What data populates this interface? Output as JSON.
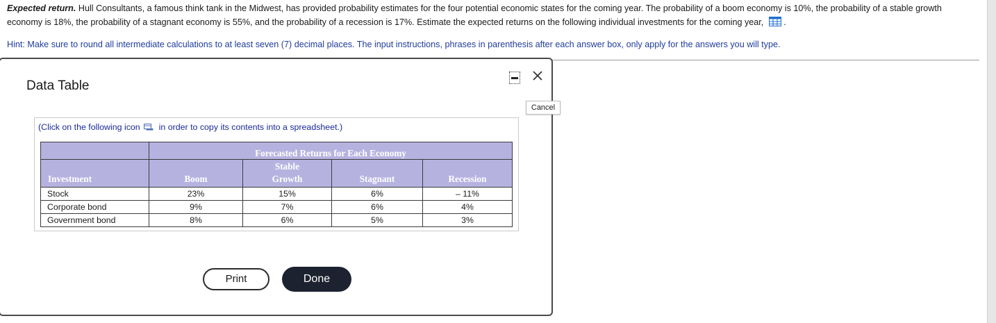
{
  "problem": {
    "lead": "Expected return.",
    "text": "Hull Consultants, a famous think tank in the Midwest, has provided probability estimates for the four potential economic states for the coming year.  The probability of a boom economy is 10%, the probability of a stable growth economy is 18%, the probability of a stagnant economy is 55%, and the probability of a recession is 17%.  Estimate the expected returns on the following individual investments for the coming year,",
    "after_icon": "."
  },
  "hint": "Hint: Make sure to round all intermediate calculations to at least seven (7) decimal places. The input instructions, phrases in parenthesis after each answer box, only apply for the answers you will type.",
  "dialog": {
    "title": "Data Table",
    "cancel_label": "Cancel",
    "copy_note_before": "(Click on the following icon",
    "copy_note_after": "in order to copy its contents into a spreadsheet.)",
    "print_label": "Print",
    "done_label": "Done"
  },
  "table": {
    "group_header": "Forecasted Returns for Each Economy",
    "headers": {
      "investment": "Investment",
      "boom": "Boom",
      "stable_line1": "Stable",
      "stable_line2": "Growth",
      "stagnant": "Stagnant",
      "recession": "Recession"
    },
    "rows": [
      {
        "name": "Stock",
        "boom": "23%",
        "stable": "15%",
        "stagnant": "6%",
        "recession": "– 11%"
      },
      {
        "name": "Corporate bond",
        "boom": "9%",
        "stable": "7%",
        "stagnant": "6%",
        "recession": "4%"
      },
      {
        "name": "Government bond",
        "boom": "8%",
        "stable": "6%",
        "stagnant": "5%",
        "recession": "3%"
      }
    ]
  },
  "colors": {
    "header_bg": "#b6b2e0",
    "hint_text": "#1f3c9c",
    "done_bg": "#1c2230"
  },
  "icons": [
    "table-grid-icon",
    "copy-spreadsheet-icon",
    "minimize-icon",
    "close-icon"
  ]
}
